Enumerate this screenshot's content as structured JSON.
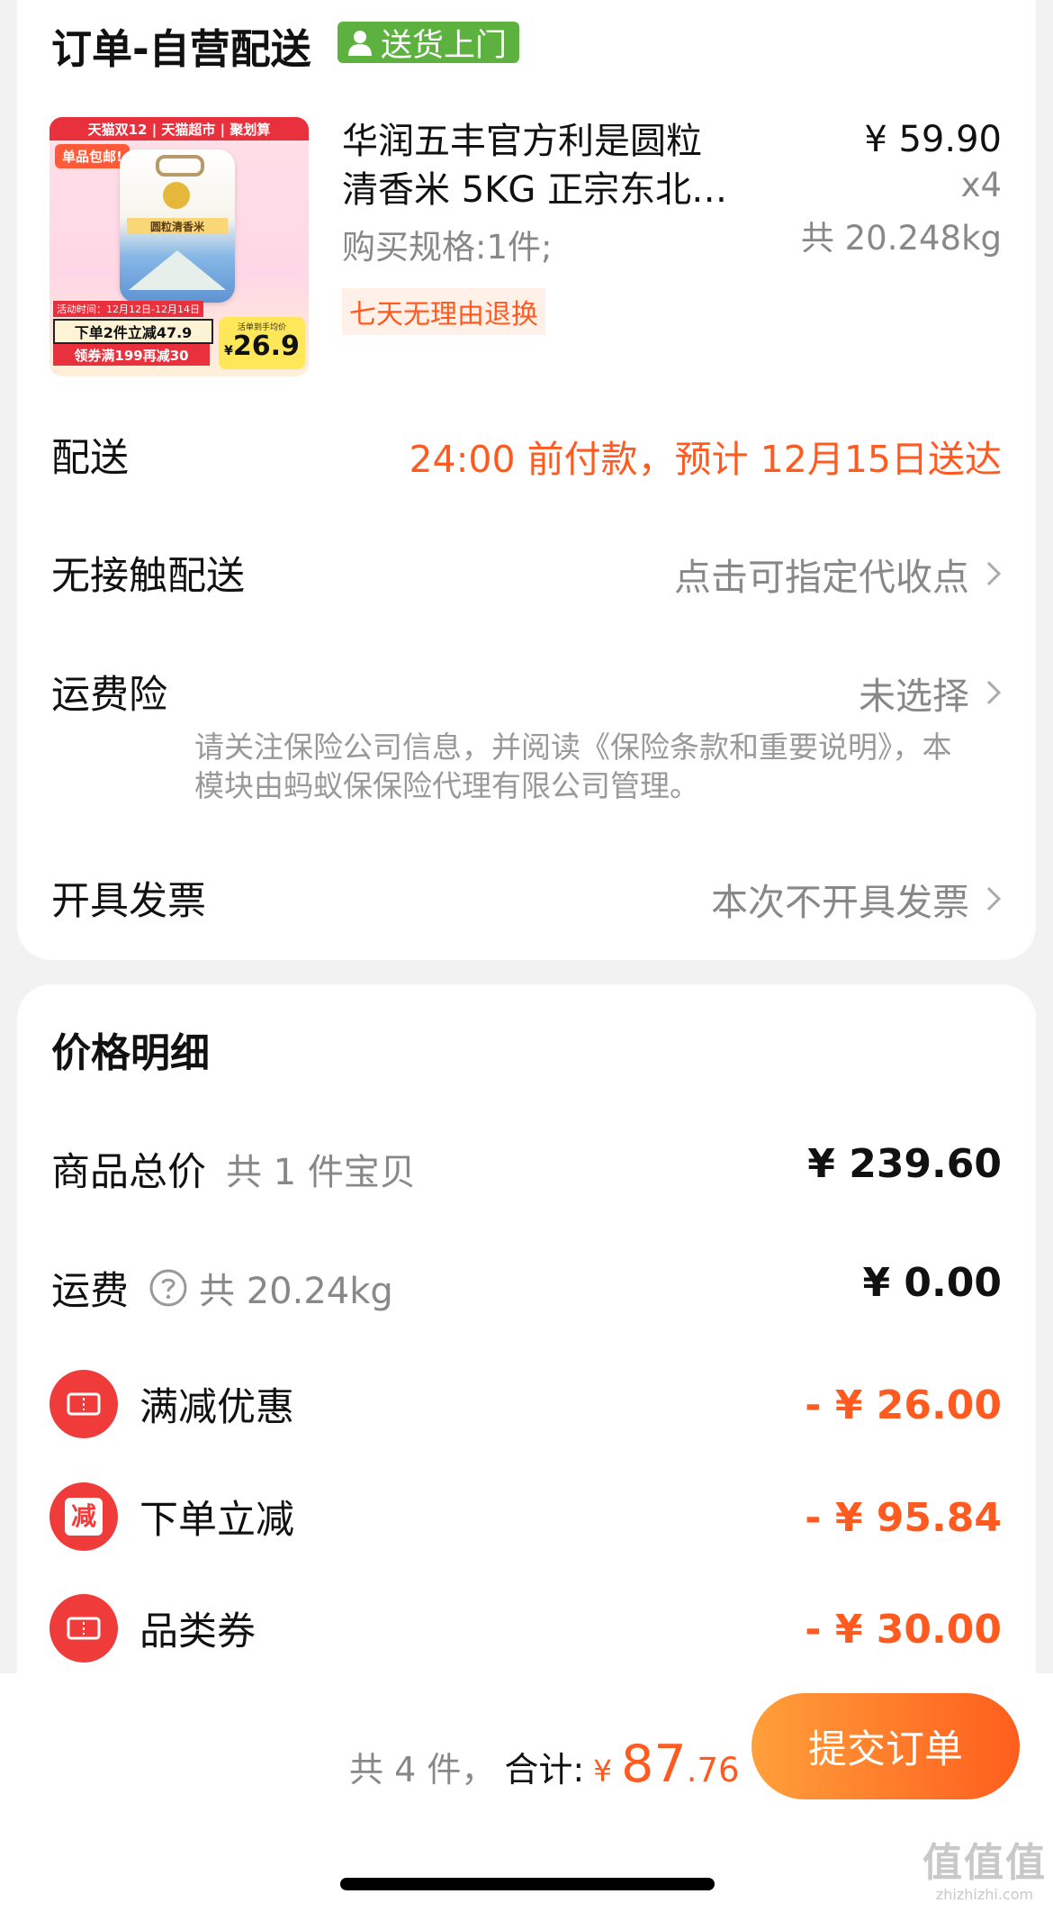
{
  "colors": {
    "accent": "#ff5a1f",
    "badge_green": "#5db23f",
    "discount_red": "#f03b3b",
    "button_start": "#ff9f3a",
    "button_end": "#ff5e1d"
  },
  "order": {
    "title": "订单-自营配送",
    "badge": "送货上门",
    "badge_icon": "person-icon"
  },
  "product": {
    "image_texts": {
      "top_banner": "天猫双12 | 天猫超市 | 聚划算",
      "tag": "单品包邮!",
      "bag_label": "圆粒清香米",
      "date": "活动时间：12月12日-12月14日",
      "promo1": "下单2件立减47.9",
      "promo2": "领券满199再减30",
      "price_caption": "活单到手均价",
      "price_currency": "¥",
      "price": "26.9"
    },
    "name_line1": "华润五丰官方利是圆粒",
    "name_line2": "清香米 5KG 正宗东北…",
    "spec": "购买规格:1件;",
    "return_policy": "七天无理由退换",
    "price": "¥ 59.90",
    "quantity": "x4",
    "weight": "共 20.248kg"
  },
  "delivery": {
    "label": "配送",
    "value": "24:00 前付款，预计 12月15日送达"
  },
  "contactless": {
    "label": "无接触配送",
    "value": "点击可指定代收点"
  },
  "insurance": {
    "label": "运费险",
    "value": "未选择",
    "note": "请关注保险公司信息，并阅读《保险条款和重要说明》，本模块由蚂蚁保保险代理有限公司管理。"
  },
  "invoice": {
    "label": "开具发票",
    "value": "本次不开具发票"
  },
  "price_detail": {
    "title": "价格明细",
    "goods_total": {
      "label": "商品总价",
      "sub": "共 1 件宝贝",
      "value": "¥ 239.60"
    },
    "shipping": {
      "label": "运费",
      "sub": "共 20.24kg",
      "value": "¥ 0.00"
    },
    "discounts": [
      {
        "label": "满减优惠",
        "value": "- ¥ 26.00",
        "icon": "ticket-icon"
      },
      {
        "label": "下单立减",
        "value": "- ¥ 95.84",
        "icon": "reduce-icon",
        "icon_text": "减"
      },
      {
        "label": "品类券",
        "value": "- ¥ 30.00",
        "icon": "ticket-icon"
      }
    ]
  },
  "bottom_bar": {
    "count": "共 4 件，",
    "total_label": "合计:",
    "currency": "¥",
    "total_int": "87",
    "total_dec": ".76",
    "submit": "提交订单"
  },
  "watermark": {
    "cn": "值值值",
    "en": "zhizhizhi.com"
  }
}
